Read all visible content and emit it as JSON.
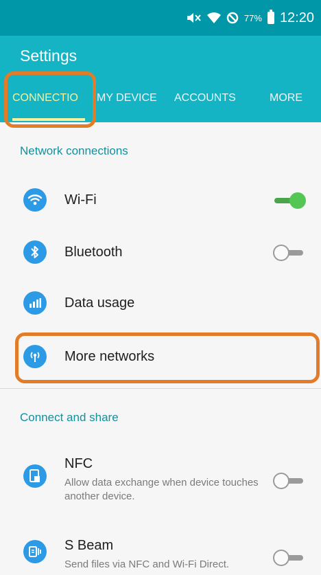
{
  "status_bar": {
    "battery_percent": "77%",
    "time": "12:20",
    "icons": [
      "mute-icon",
      "wifi-icon",
      "blocked-icon",
      "battery-icon"
    ]
  },
  "app": {
    "title": "Settings",
    "tabs": [
      {
        "label": "CONNECTIO",
        "active": true
      },
      {
        "label": "MY DEVICE",
        "active": false
      },
      {
        "label": "ACCOUNTS",
        "active": false
      },
      {
        "label": "MORE",
        "active": false
      }
    ]
  },
  "sections": {
    "network": {
      "header": "Network connections",
      "items": [
        {
          "title": "Wi-Fi",
          "icon": "wifi-icon",
          "toggle": true
        },
        {
          "title": "Bluetooth",
          "icon": "bluetooth-icon",
          "toggle": false
        },
        {
          "title": "Data usage",
          "icon": "data-usage-icon"
        },
        {
          "title": "More networks",
          "icon": "antenna-icon"
        }
      ]
    },
    "share": {
      "header": "Connect and share",
      "items": [
        {
          "title": "NFC",
          "subtitle": "Allow data exchange when device touches another device.",
          "icon": "nfc-icon",
          "toggle": false
        },
        {
          "title": "S Beam",
          "subtitle": "Send files via NFC and Wi-Fi Direct.",
          "icon": "s-beam-icon",
          "toggle": false
        }
      ]
    }
  },
  "colors": {
    "status_bar": "#0097a8",
    "app_bar": "#14b4c4",
    "active_tab": "#f8f19b",
    "section_header": "#138f9d",
    "icon_blue": "#2d9ae6",
    "highlight": "#e37c28",
    "toggle_on": "#53c653"
  }
}
